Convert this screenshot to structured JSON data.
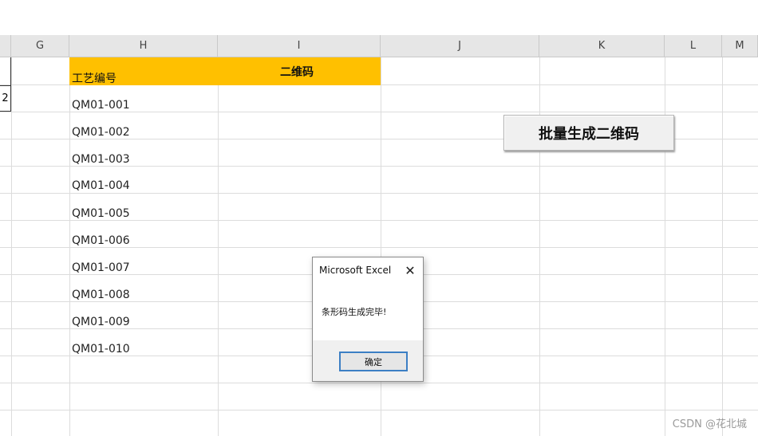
{
  "columns": [
    "G",
    "H",
    "I",
    "J",
    "K",
    "L",
    "M"
  ],
  "left_cell_value": "2",
  "table": {
    "header_h": "工艺编号",
    "header_i": "二维码",
    "rows": [
      "QM01-001",
      "QM01-002",
      "QM01-003",
      "QM01-004",
      "QM01-005",
      "QM01-006",
      "QM01-007",
      "QM01-008",
      "QM01-009",
      "QM01-010"
    ]
  },
  "batch_button": {
    "label": "批量生成二维码"
  },
  "dialog": {
    "title": "Microsoft Excel",
    "close_icon": "✕",
    "message": "条形码生成完毕!",
    "ok_label": "确定"
  },
  "watermark": "CSDN @花北城",
  "colors": {
    "header_fill": "#ffc000",
    "grid_line": "#dcdcdc",
    "ok_border": "#3c7fc4"
  }
}
